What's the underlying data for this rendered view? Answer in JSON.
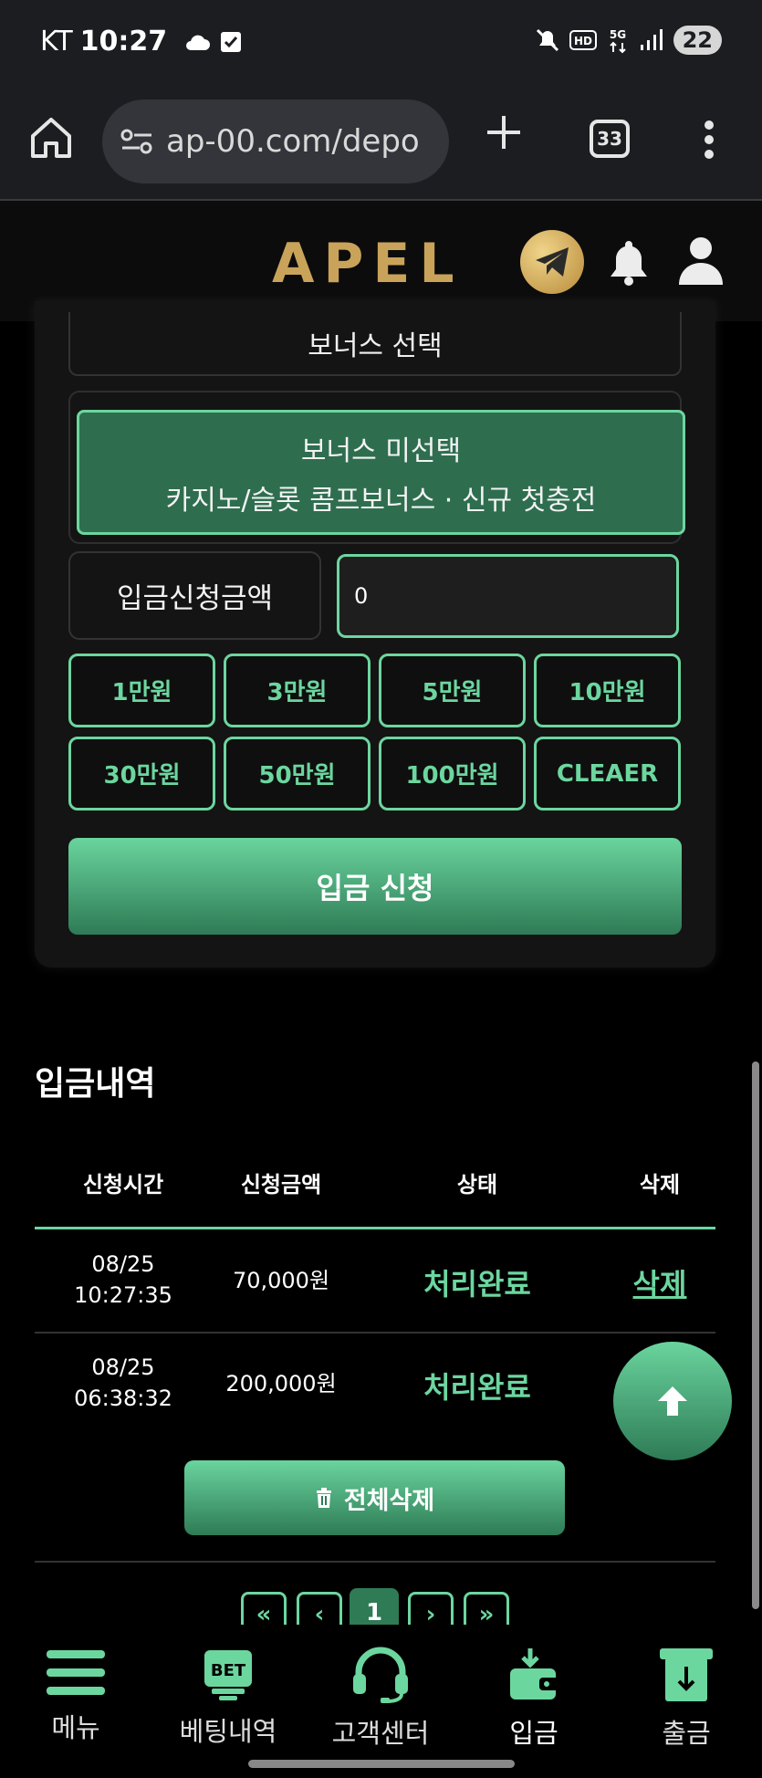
{
  "status_bar": {
    "carrier": "KT",
    "time": "10:27",
    "battery": "22"
  },
  "browser": {
    "url": "ap-00.com/depo",
    "tab_count": "33"
  },
  "header": {
    "logo": "APEL"
  },
  "form": {
    "bonus_select_label": "보너스 선택",
    "bonus_option_line1": "보너스 미선택",
    "bonus_option_line2": "카지노/슬롯 콤프보너스 · 신규 첫충전",
    "amount_label": "입금신청금액",
    "amount_value": "0",
    "amount_buttons": [
      "1만원",
      "3만원",
      "5만원",
      "10만원",
      "30만원",
      "50만원",
      "100만원",
      "CLEAER"
    ],
    "submit_label": "입금 신청"
  },
  "history": {
    "title": "입금내역",
    "columns": [
      "신청시간",
      "신청금액",
      "상태",
      "삭제"
    ],
    "rows": [
      {
        "date": "08/25",
        "time": "10:27:35",
        "amount": "70,000원",
        "status": "처리완료",
        "delete": "삭제"
      },
      {
        "date": "08/25",
        "time": "06:38:32",
        "amount": "200,000원",
        "status": "처리완료",
        "delete": ""
      }
    ],
    "delete_all_label": "전체삭제",
    "pagination": {
      "first": "«",
      "prev": "‹",
      "current": "1",
      "next": "›",
      "last": "»"
    }
  },
  "bottom_nav": [
    {
      "label": "메뉴",
      "icon": "hamburger-icon"
    },
    {
      "label": "베팅내역",
      "icon": "bet-icon"
    },
    {
      "label": "고객센터",
      "icon": "headset-icon"
    },
    {
      "label": "입금",
      "icon": "wallet-deposit-icon",
      "active": true
    },
    {
      "label": "출금",
      "icon": "withdraw-icon"
    }
  ],
  "colors": {
    "accent": "#6cd69f",
    "accent_dark": "#2e7b55",
    "gold": "#c9a35a"
  }
}
